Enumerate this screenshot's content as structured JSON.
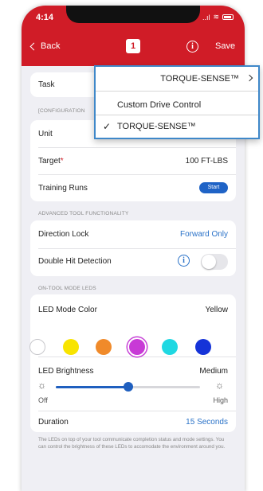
{
  "status_bar": {
    "time": "4:14",
    "signal": "..ıl"
  },
  "nav": {
    "back_label": "Back",
    "tool_number": "1",
    "info_glyph": "i",
    "save_label": "Save"
  },
  "task": {
    "label": "Task",
    "partial_section": "[CONFIGURATION",
    "dropdown": {
      "current": "TORQUE-SENSE™",
      "options": [
        {
          "label": "Custom Drive Control",
          "selected": false
        },
        {
          "label": "TORQUE-SENSE™",
          "selected": true
        }
      ],
      "check_glyph": "✓"
    }
  },
  "config": {
    "unit_label": "Unit",
    "target_label": "Target",
    "target_required": "*",
    "target_value": "100 FT-LBS",
    "training_label": "Training Runs",
    "start_label": "Start"
  },
  "advanced": {
    "section_label": "ADVANCED TOOL FUNCTIONALITY",
    "direction_label": "Direction Lock",
    "direction_value": "Forward Only",
    "double_hit_label": "Double Hit Detection",
    "double_hit_enabled": false,
    "info_glyph": "i"
  },
  "leds": {
    "section_label": "ON-TOOL MODE LEDS",
    "color_label": "LED Mode Color",
    "color_value": "Yellow",
    "swatches": [
      {
        "name": "white",
        "color": "#ffffff"
      },
      {
        "name": "yellow",
        "color": "#f8e400"
      },
      {
        "name": "orange",
        "color": "#f08a2a"
      },
      {
        "name": "purple",
        "color": "#c83ad6"
      },
      {
        "name": "cyan",
        "color": "#1fd8e2"
      },
      {
        "name": "blue",
        "color": "#1533d8"
      }
    ],
    "selected_swatch_index": 3,
    "brightness_label": "LED Brightness",
    "brightness_value": "Medium",
    "brightness_fraction": 0.5,
    "min_label": "Off",
    "max_label": "High",
    "sun_glyph": "☼",
    "duration_label": "Duration",
    "duration_value": "15 Seconds",
    "footnote": "The LEDs on top of your tool communicate completion status and mode settings. You can control the brightness of these LEDs to accomodate the environment around you."
  },
  "colors": {
    "brand_red": "#d01c27",
    "accent_blue": "#2a72c8",
    "toggle_off": "#e6e6ea"
  }
}
